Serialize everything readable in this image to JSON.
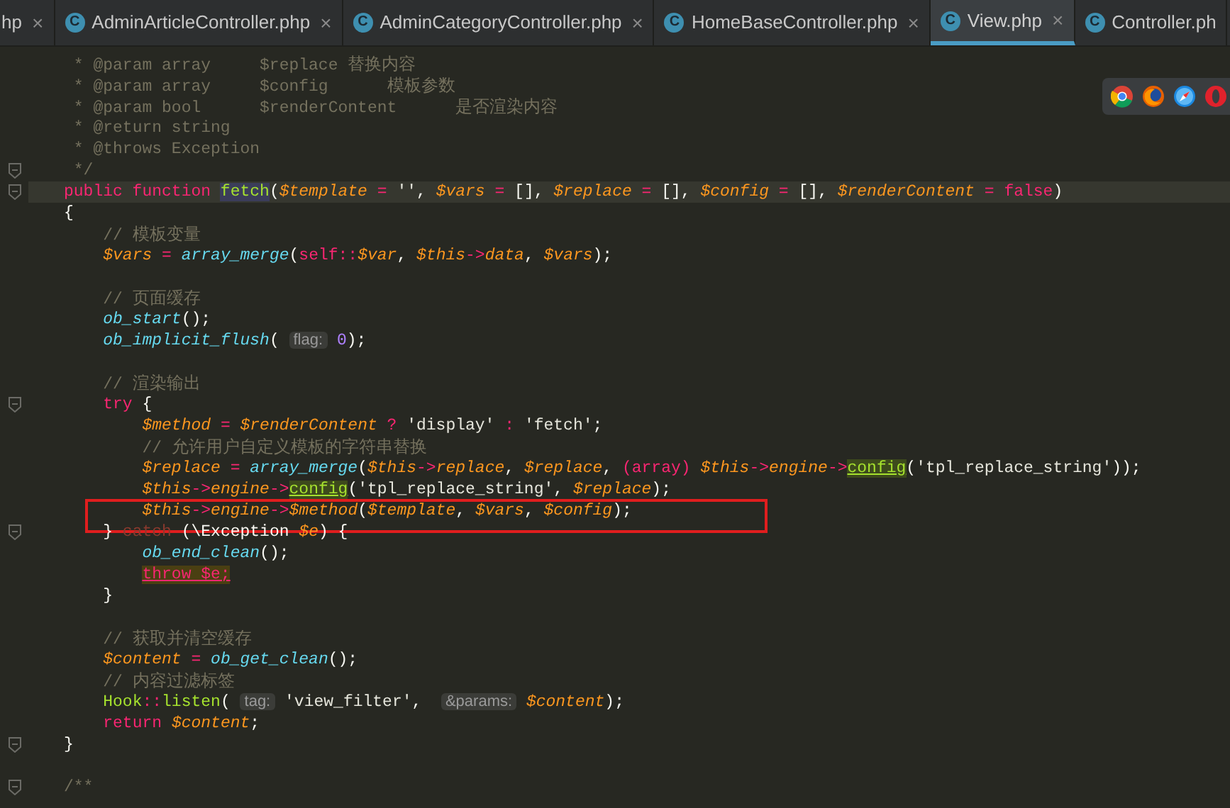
{
  "tabs": [
    {
      "label": "hp",
      "close": "×",
      "selected": false
    },
    {
      "label": "AdminArticleController.php",
      "icon_letter": "C",
      "close": "×",
      "selected": false
    },
    {
      "label": "AdminCategoryController.php",
      "icon_letter": "C",
      "close": "×",
      "selected": false
    },
    {
      "label": "HomeBaseController.php",
      "icon_letter": "C",
      "close": "×",
      "selected": false
    },
    {
      "label": "View.php",
      "icon_letter": "C",
      "close": "×",
      "selected": true
    },
    {
      "label": "Controller.ph",
      "icon_letter": "C",
      "selected": false
    }
  ],
  "code_lines": [
    {
      "segments": [
        {
          "kind": "comment",
          "text": " * @param array     $replace "
        },
        {
          "kind": "comment_cjk",
          "text": "替换内容"
        }
      ]
    },
    {
      "segments": [
        {
          "kind": "comment",
          "text": " * @param array     $config      "
        },
        {
          "kind": "comment_cjk",
          "text": "模板参数"
        }
      ]
    },
    {
      "segments": [
        {
          "kind": "comment",
          "text": " * @param bool      $renderContent      "
        },
        {
          "kind": "comment_cjk",
          "text": "是否渲染内容"
        }
      ]
    },
    {
      "segments": [
        {
          "kind": "comment",
          "text": " * @return string"
        }
      ]
    },
    {
      "segments": [
        {
          "kind": "comment",
          "text": " * @throws Exception"
        }
      ]
    },
    {
      "fold": true,
      "segments": [
        {
          "kind": "comment",
          "text": " */"
        }
      ]
    },
    {
      "fold": true,
      "current": true,
      "segments": [
        {
          "kind": "keyword",
          "text": "public function "
        },
        {
          "kind": "definition",
          "text": "fetch"
        },
        {
          "kind": "plain",
          "text": "("
        },
        {
          "kind": "variable",
          "text": "$template"
        },
        {
          "kind": "operator",
          "text": " = "
        },
        {
          "kind": "string",
          "text": "''"
        },
        {
          "kind": "plain",
          "text": ", "
        },
        {
          "kind": "variable",
          "text": "$vars"
        },
        {
          "kind": "operator",
          "text": " = "
        },
        {
          "kind": "plain",
          "text": "[], "
        },
        {
          "kind": "variable",
          "text": "$replace"
        },
        {
          "kind": "operator",
          "text": " = "
        },
        {
          "kind": "plain",
          "text": "[], "
        },
        {
          "kind": "variable",
          "text": "$config"
        },
        {
          "kind": "operator",
          "text": " = "
        },
        {
          "kind": "plain",
          "text": "[], "
        },
        {
          "kind": "variable",
          "text": "$renderContent"
        },
        {
          "kind": "operator",
          "text": " = "
        },
        {
          "kind": "keyword",
          "text": "false"
        },
        {
          "kind": "plain",
          "text": ")"
        }
      ]
    },
    {
      "segments": [
        {
          "kind": "plain",
          "text": "{"
        }
      ]
    },
    {
      "segments": [
        {
          "kind": "comment",
          "text": "    // "
        },
        {
          "kind": "comment_cjk",
          "text": "模板变量"
        }
      ]
    },
    {
      "segments": [
        {
          "kind": "variable",
          "text": "    $vars"
        },
        {
          "kind": "operator",
          "text": " = "
        },
        {
          "kind": "call",
          "text": "array_merge"
        },
        {
          "kind": "plain",
          "text": "("
        },
        {
          "kind": "keyword",
          "text": "self"
        },
        {
          "kind": "operator",
          "text": "::"
        },
        {
          "kind": "variable",
          "text": "$var"
        },
        {
          "kind": "plain",
          "text": ", "
        },
        {
          "kind": "variable",
          "text": "$this"
        },
        {
          "kind": "operator",
          "text": "->"
        },
        {
          "kind": "variable",
          "text": "data"
        },
        {
          "kind": "plain",
          "text": ", "
        },
        {
          "kind": "variable",
          "text": "$vars"
        },
        {
          "kind": "plain",
          "text": ");"
        }
      ]
    },
    {
      "gap_before": true,
      "segments": [
        {
          "kind": "comment",
          "text": "    // "
        },
        {
          "kind": "comment_cjk",
          "text": "页面缓存"
        }
      ]
    },
    {
      "segments": [
        {
          "kind": "call",
          "text": "    ob_start"
        },
        {
          "kind": "plain",
          "text": "();"
        }
      ]
    },
    {
      "segments": [
        {
          "kind": "call",
          "text": "    ob_implicit_flush"
        },
        {
          "kind": "plain",
          "text": "( "
        },
        {
          "kind": "hint",
          "text": "flag:"
        },
        {
          "kind": "number",
          "text": " 0"
        },
        {
          "kind": "plain",
          "text": ");"
        }
      ]
    },
    {
      "gap_before": true,
      "segments": [
        {
          "kind": "comment",
          "text": "    // "
        },
        {
          "kind": "comment_cjk",
          "text": "渲染输出"
        }
      ]
    },
    {
      "fold": true,
      "segments": [
        {
          "kind": "keyword",
          "text": "    try"
        },
        {
          "kind": "plain",
          "text": " {"
        }
      ]
    },
    {
      "segments": [
        {
          "kind": "variable",
          "text": "        $method"
        },
        {
          "kind": "operator",
          "text": " = "
        },
        {
          "kind": "variable",
          "text": "$renderContent"
        },
        {
          "kind": "operator",
          "text": " ? "
        },
        {
          "kind": "string",
          "text": "'display'"
        },
        {
          "kind": "operator",
          "text": " : "
        },
        {
          "kind": "string",
          "text": "'fetch'"
        },
        {
          "kind": "plain",
          "text": ";"
        }
      ]
    },
    {
      "segments": [
        {
          "kind": "comment",
          "text": "        // "
        },
        {
          "kind": "comment_cjk",
          "text": "允许用户自定义模板的字符串替换"
        }
      ]
    },
    {
      "segments": [
        {
          "kind": "variable",
          "text": "        $replace"
        },
        {
          "kind": "operator",
          "text": " = "
        },
        {
          "kind": "call",
          "text": "array_merge"
        },
        {
          "kind": "plain",
          "text": "("
        },
        {
          "kind": "variable",
          "text": "$this"
        },
        {
          "kind": "operator",
          "text": "->"
        },
        {
          "kind": "variable",
          "text": "replace"
        },
        {
          "kind": "plain",
          "text": ", "
        },
        {
          "kind": "variable",
          "text": "$replace"
        },
        {
          "kind": "plain",
          "text": ", "
        },
        {
          "kind": "keyword",
          "text": "(array)"
        },
        {
          "kind": "variable",
          "text": " $this"
        },
        {
          "kind": "operator",
          "text": "->"
        },
        {
          "kind": "variable",
          "text": "engine"
        },
        {
          "kind": "operator",
          "text": "->"
        },
        {
          "kind": "method",
          "text": "config"
        },
        {
          "kind": "plain",
          "text": "("
        },
        {
          "kind": "string",
          "text": "'tpl_replace_string'"
        },
        {
          "kind": "plain",
          "text": "));"
        }
      ]
    },
    {
      "segments": [
        {
          "kind": "variable",
          "text": "        $this"
        },
        {
          "kind": "operator",
          "text": "->"
        },
        {
          "kind": "variable",
          "text": "engine"
        },
        {
          "kind": "operator",
          "text": "->"
        },
        {
          "kind": "method",
          "text": "config"
        },
        {
          "kind": "plain",
          "text": "("
        },
        {
          "kind": "string",
          "text": "'tpl_replace_string'"
        },
        {
          "kind": "plain",
          "text": ", "
        },
        {
          "kind": "variable",
          "text": "$replace"
        },
        {
          "kind": "plain",
          "text": ");"
        }
      ]
    },
    {
      "boxed": true,
      "segments": [
        {
          "kind": "variable",
          "text": "        $this"
        },
        {
          "kind": "operator",
          "text": "->"
        },
        {
          "kind": "variable",
          "text": "engine"
        },
        {
          "kind": "operator",
          "text": "->"
        },
        {
          "kind": "variable",
          "text": "$method"
        },
        {
          "kind": "plain",
          "text": "("
        },
        {
          "kind": "variable",
          "text": "$template"
        },
        {
          "kind": "plain",
          "text": ", "
        },
        {
          "kind": "variable",
          "text": "$vars"
        },
        {
          "kind": "plain",
          "text": ", "
        },
        {
          "kind": "variable",
          "text": "$config"
        },
        {
          "kind": "plain",
          "text": ");"
        }
      ]
    },
    {
      "fold": true,
      "segments": [
        {
          "kind": "plain",
          "text": "    } "
        },
        {
          "kind": "dim_keyword",
          "text": "catch"
        },
        {
          "kind": "plain",
          "text": " (\\Exception "
        },
        {
          "kind": "variable",
          "text": "$e"
        },
        {
          "kind": "plain",
          "text": ") {"
        }
      ]
    },
    {
      "segments": [
        {
          "kind": "call",
          "text": "        ob_end_clean"
        },
        {
          "kind": "plain",
          "text": "();"
        }
      ]
    },
    {
      "segments": [
        {
          "kind": "throw",
          "text": "        throw $e;"
        }
      ]
    },
    {
      "segments": [
        {
          "kind": "plain",
          "text": "    }"
        }
      ]
    },
    {
      "gap_before": true,
      "segments": [
        {
          "kind": "comment",
          "text": "    // "
        },
        {
          "kind": "comment_cjk",
          "text": "获取并清空缓存"
        }
      ]
    },
    {
      "segments": [
        {
          "kind": "variable",
          "text": "    $content"
        },
        {
          "kind": "operator",
          "text": " = "
        },
        {
          "kind": "call",
          "text": "ob_get_clean"
        },
        {
          "kind": "plain",
          "text": "();"
        }
      ]
    },
    {
      "segments": [
        {
          "kind": "comment",
          "text": "    // "
        },
        {
          "kind": "comment_cjk",
          "text": "内容过滤标签"
        }
      ]
    },
    {
      "segments": [
        {
          "kind": "class",
          "text": "    Hook"
        },
        {
          "kind": "operator",
          "text": "::"
        },
        {
          "kind": "class",
          "text": "listen"
        },
        {
          "kind": "plain",
          "text": "( "
        },
        {
          "kind": "hint",
          "text": "tag:"
        },
        {
          "kind": "string",
          "text": " 'view_filter'"
        },
        {
          "kind": "plain",
          "text": ",  "
        },
        {
          "kind": "hint",
          "text": "&params:"
        },
        {
          "kind": "variable",
          "text": " $content"
        },
        {
          "kind": "plain",
          "text": ");"
        }
      ]
    },
    {
      "segments": [
        {
          "kind": "keyword",
          "text": "    return"
        },
        {
          "kind": "variable",
          "text": " $content"
        },
        {
          "kind": "plain",
          "text": ";"
        }
      ]
    },
    {
      "fold": true,
      "segments": [
        {
          "kind": "plain",
          "text": "}"
        }
      ]
    },
    {
      "gap_before": true,
      "fold": true,
      "segments": [
        {
          "kind": "comment",
          "text": "/**"
        }
      ]
    }
  ]
}
